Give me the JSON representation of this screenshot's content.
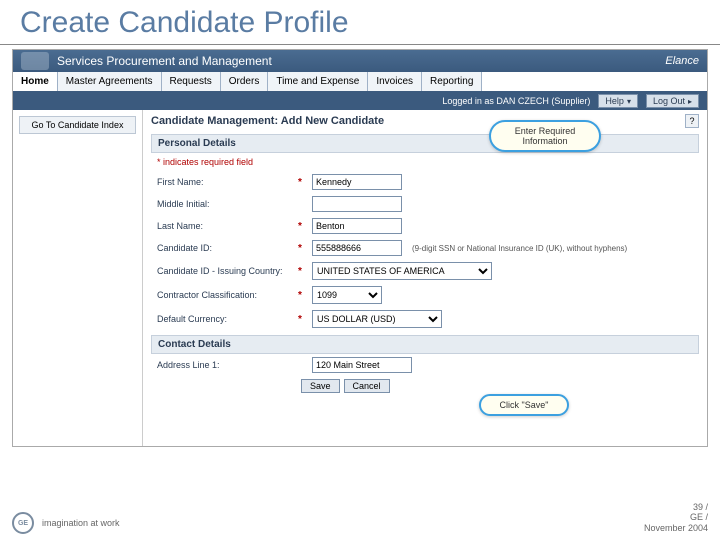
{
  "slide": {
    "title": "Create Candidate Profile"
  },
  "header": {
    "app_title": "Services Procurement and Management",
    "brand": "Elance"
  },
  "tabs": [
    "Home",
    "Master Agreements",
    "Requests",
    "Orders",
    "Time and Expense",
    "Invoices",
    "Reporting"
  ],
  "subbar": {
    "logged_in": "Logged in as DAN CZECH (Supplier)",
    "help": "Help",
    "logout": "Log Out"
  },
  "side": {
    "back": "Go To Candidate Index"
  },
  "page": {
    "title": "Candidate Management: Add New Candidate",
    "help_icon": "?"
  },
  "sections": {
    "personal": "Personal Details",
    "contact": "Contact Details"
  },
  "req_note": "* indicates required field",
  "fields": {
    "first_name": {
      "label": "First Name:",
      "value": "Kennedy"
    },
    "middle": {
      "label": "Middle Initial:",
      "value": ""
    },
    "last_name": {
      "label": "Last Name:",
      "value": "Benton"
    },
    "candidate_id": {
      "label": "Candidate ID:",
      "value": "555888666",
      "hint": "(9-digit SSN or National Insurance ID (UK), without hyphens)"
    },
    "country": {
      "label": "Candidate ID - Issuing Country:",
      "value": "UNITED STATES OF AMERICA"
    },
    "classification": {
      "label": "Contractor Classification:",
      "value": "1099"
    },
    "currency": {
      "label": "Default Currency:",
      "value": "US DOLLAR (USD)"
    },
    "address1": {
      "label": "Address Line 1:",
      "value": "120 Main Street"
    }
  },
  "buttons": {
    "save": "Save",
    "cancel": "Cancel"
  },
  "callouts": {
    "c1": "Enter Required Information",
    "c2": "Click \"Save\""
  },
  "footer": {
    "tagline": "imagination at work",
    "page": "39 /",
    "org": "GE /",
    "date": "November 2004"
  }
}
